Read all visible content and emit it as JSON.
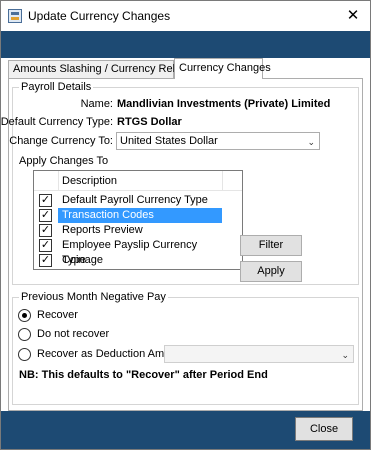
{
  "window": {
    "title": "Update Currency Changes",
    "close_glyph": "✕"
  },
  "tabs": [
    {
      "label": "Amounts Slashing / Currency Rebasing",
      "active": false
    },
    {
      "label": "Currency Changes",
      "active": true
    }
  ],
  "payroll_details": {
    "group_title": "Payroll Details",
    "name_label": "Name:",
    "name_value": "Mandlivian Investments (Private) Limited",
    "default_currency_label": "Default Currency Type:",
    "default_currency_value": "RTGS Dollar",
    "change_currency_label": "Change Currency To:",
    "change_currency_value": "United States Dollar",
    "apply_changes_label": "Apply Changes To",
    "list_header": "Description",
    "items": [
      {
        "label": "Default Payroll Currency Type",
        "checked": true,
        "selected": false
      },
      {
        "label": "Transaction Codes",
        "checked": true,
        "selected": true
      },
      {
        "label": "Reports Preview",
        "checked": true,
        "selected": false
      },
      {
        "label": "Employee Payslip Currency Type",
        "checked": true,
        "selected": false
      },
      {
        "label": "Coinage",
        "checked": true,
        "selected": false
      }
    ],
    "filter_button": "Filter",
    "apply_button": "Apply"
  },
  "negative_pay": {
    "group_title": "Previous Month Negative Pay",
    "options": [
      {
        "label": "Recover",
        "checked": true
      },
      {
        "label": "Do not recover",
        "checked": false
      },
      {
        "label": "Recover as Deduction Amount",
        "checked": false
      }
    ],
    "deduction_value": "",
    "note": "NB: This defaults to \"Recover\" after Period End"
  },
  "footer": {
    "close_button": "Close"
  },
  "colors": {
    "banner": "#1d4a73",
    "selection": "#3399ff"
  }
}
